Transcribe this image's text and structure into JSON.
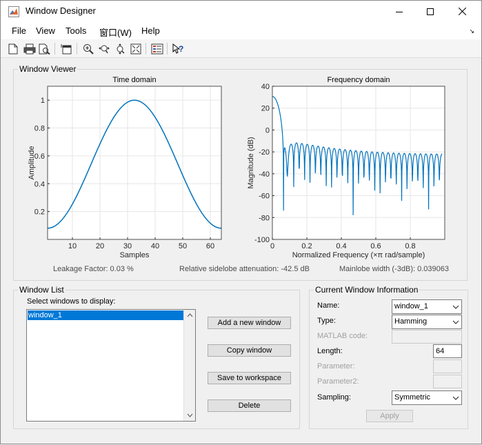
{
  "window": {
    "title": "Window Designer"
  },
  "menu": {
    "file": "File",
    "view": "View",
    "tools": "Tools",
    "window": "窗口(W)",
    "help": "Help"
  },
  "toolbar_icons": [
    "new-icon",
    "print-icon",
    "print-preview-icon",
    "new-window-icon",
    "zoom-in-icon",
    "zoom-x-icon",
    "zoom-y-icon",
    "full-view-icon",
    "legend-icon",
    "whats-this-icon"
  ],
  "viewer": {
    "group_label": "Window Viewer",
    "time_title": "Time domain",
    "time_xlabel": "Samples",
    "time_ylabel": "Amplitude",
    "time_xticks": [
      "10",
      "20",
      "30",
      "40",
      "50",
      "60"
    ],
    "time_yticks": [
      "0.2",
      "0.4",
      "0.6",
      "0.8",
      "1"
    ],
    "freq_title": "Frequency domain",
    "freq_xlabel": "Normalized Frequency  (×π rad/sample)",
    "freq_ylabel": "Magnitude (dB)",
    "freq_xticks": [
      "0",
      "0.2",
      "0.4",
      "0.6",
      "0.8"
    ],
    "freq_yticks": [
      "40",
      "20",
      "0",
      "-20",
      "-40",
      "-60",
      "-80",
      "-100"
    ],
    "leakage": "Leakage Factor: 0.03 %",
    "sidelobe": "Relative sidelobe attenuation: -42.5 dB",
    "mainlobe": "Mainlobe width (-3dB): 0.039063"
  },
  "chart_data": [
    {
      "type": "line",
      "title": "Time domain",
      "xlabel": "Samples",
      "ylabel": "Amplitude",
      "xlim": [
        1,
        64
      ],
      "ylim": [
        0,
        1.1
      ],
      "grid": true,
      "series": [
        {
          "window": "Hamming",
          "length": 64,
          "min": 0.08,
          "max": 1.0
        }
      ],
      "color": "#0072bd"
    },
    {
      "type": "line",
      "title": "Frequency domain",
      "xlabel": "Normalized Frequency  (×π rad/sample)",
      "ylabel": "Magnitude (dB)",
      "xlim": [
        0,
        1
      ],
      "ylim": [
        -100,
        40
      ],
      "grid": true,
      "peak_db": 30.1,
      "first_sidelobe_db": -12.4,
      "last_sidelobe_db": -21.6,
      "color": "#0072bd"
    }
  ],
  "window_list": {
    "group_label": "Window List",
    "select_label": "Select windows to display:",
    "items": [
      "window_1"
    ],
    "add_button": "Add a new window",
    "copy_button": "Copy window",
    "save_button": "Save to workspace",
    "delete_button": "Delete"
  },
  "current_info": {
    "group_label": "Current Window Information",
    "name_label": "Name:",
    "name_value": "window_1",
    "type_label": "Type:",
    "type_value": "Hamming",
    "matlab_label": "MATLAB code:",
    "length_label": "Length:",
    "length_value": "64",
    "parameter_label": "Parameter:",
    "parameter2_label": "Parameter2:",
    "sampling_label": "Sampling:",
    "sampling_value": "Symmetric",
    "apply_button": "Apply"
  },
  "colors": {
    "line": "#0072bd",
    "selection": "#0078d7",
    "grid": "#e6e6e6"
  }
}
